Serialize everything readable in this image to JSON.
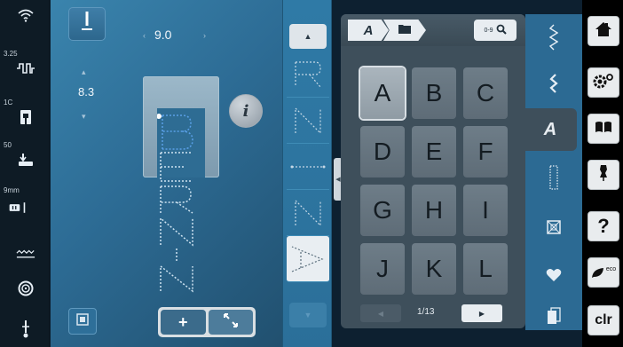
{
  "status_bar": {
    "upper_thread_tension": "3.25",
    "presser_foot": "1C",
    "presser_foot_pressure": "50",
    "needle_size": "9mm"
  },
  "stitch_settings": {
    "width": "9.0",
    "length": "8.3"
  },
  "alphabet_panel": {
    "breadcrumb_font": "A",
    "search_label": "0-9",
    "letters": [
      "A",
      "B",
      "C",
      "D",
      "E",
      "F",
      "G",
      "H",
      "I",
      "J",
      "K",
      "L"
    ],
    "selected_letter": "A",
    "page": "1/13"
  },
  "stitch_preview_text": "BERNINA",
  "category_tabs": [
    "practical-stitches",
    "decorative-stitches",
    "alphabets",
    "buttonholes",
    "quilt-stitches",
    "personal-program",
    "memory"
  ],
  "right_menu": {
    "help_label": "?",
    "eco_label": "eco",
    "clear_label": "clr"
  },
  "colors": {
    "workspace_blue": "#2d6c95",
    "panel_gray": "#3e4f5b",
    "key_gray": "#6e7d88",
    "menu_black": "#000000"
  }
}
